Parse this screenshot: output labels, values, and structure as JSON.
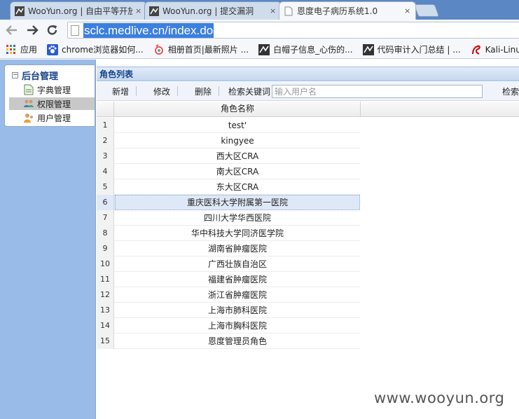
{
  "browser": {
    "tabs": [
      {
        "title": "WooYun.org | 自由平等开放",
        "active": false
      },
      {
        "title": "WooYun.org | 提交漏洞",
        "active": false
      },
      {
        "title": "恩度电子病历系统1.0",
        "active": true
      }
    ],
    "tab_close_glyph": "×",
    "address": "sclc.medlive.cn/index.do",
    "bookmarks": [
      {
        "label": "应用",
        "icon": "apps-grid-icon"
      },
      {
        "label": "chrome浏览器如何...",
        "icon": "paw-icon"
      },
      {
        "label": "相册首页|最新照片 ...",
        "icon": "album-icon"
      },
      {
        "label": "白帽子信息_心伤的...",
        "icon": "hat-icon"
      },
      {
        "label": "代码审计入门总结 | ...",
        "icon": "hat-icon"
      },
      {
        "label": "Kali-Linux",
        "icon": "dragon-icon"
      }
    ]
  },
  "sidebar": {
    "root_label": "后台管理",
    "items": [
      {
        "label": "字典管理",
        "icon": "document-icon",
        "selected": false
      },
      {
        "label": "权限管理",
        "icon": "people-group-icon",
        "selected": true
      },
      {
        "label": "用户管理",
        "icon": "users-icon",
        "selected": false
      }
    ]
  },
  "panel": {
    "title": "角色列表",
    "toolbar": {
      "add_label": "新增",
      "edit_label": "修改",
      "delete_label": "删除",
      "search_keyword_label": "检索关键词",
      "search_placeholder": "输入用户名",
      "search_button_label": "检索"
    },
    "grid": {
      "column_header": "角色名称",
      "selected_row": 6,
      "rows": [
        {
          "num": "1",
          "name": "test'"
        },
        {
          "num": "2",
          "name": "kingyee"
        },
        {
          "num": "3",
          "name": "西大区CRA"
        },
        {
          "num": "4",
          "name": "南大区CRA"
        },
        {
          "num": "5",
          "name": "东大区CRA"
        },
        {
          "num": "6",
          "name": "重庆医科大学附属第一医院"
        },
        {
          "num": "7",
          "name": "四川大学华西医院"
        },
        {
          "num": "8",
          "name": "华中科技大学同济医学院"
        },
        {
          "num": "9",
          "name": "湖南省肿瘤医院"
        },
        {
          "num": "10",
          "name": "广西壮族自治区"
        },
        {
          "num": "11",
          "name": "福建省肿瘤医院"
        },
        {
          "num": "12",
          "name": "浙江省肿瘤医院"
        },
        {
          "num": "13",
          "name": "上海市肺科医院"
        },
        {
          "num": "14",
          "name": "上海市胸科医院"
        },
        {
          "num": "15",
          "name": "恩度管理员角色"
        }
      ]
    }
  },
  "watermark": "www.wooyun.org",
  "colors": {
    "sidebar_bg": "#99bbe8",
    "header_text": "#15428b",
    "selected_row": "#dfe8f6",
    "address_highlight": "#3b7fe0"
  }
}
